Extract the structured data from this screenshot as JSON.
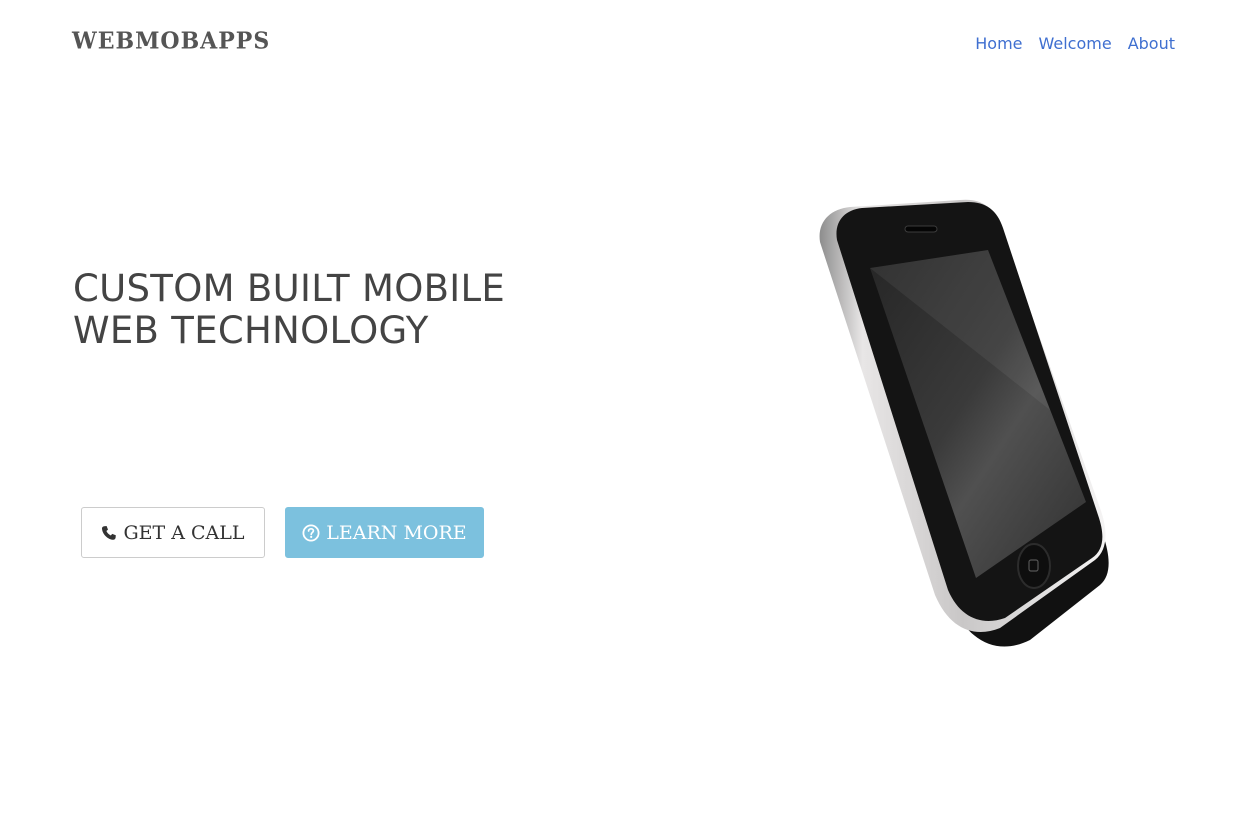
{
  "header": {
    "brand": "WEBMOBAPPS",
    "nav": [
      {
        "label": "Home"
      },
      {
        "label": "Welcome"
      },
      {
        "label": "About"
      }
    ]
  },
  "hero": {
    "headline_line1": "CUSTOM BUILT MOBILE",
    "headline_line2": "WEB TECHNOLOGY",
    "buttons": {
      "call_label": "GET A CALL",
      "call_icon": "phone-icon",
      "learn_label": "LEARN MORE",
      "learn_icon": "question-circle-icon"
    },
    "image": "smartphone-illustration"
  },
  "colors": {
    "nav_link": "#3f6fd0",
    "learn_button": "#7cc1de",
    "headline": "#444444"
  }
}
